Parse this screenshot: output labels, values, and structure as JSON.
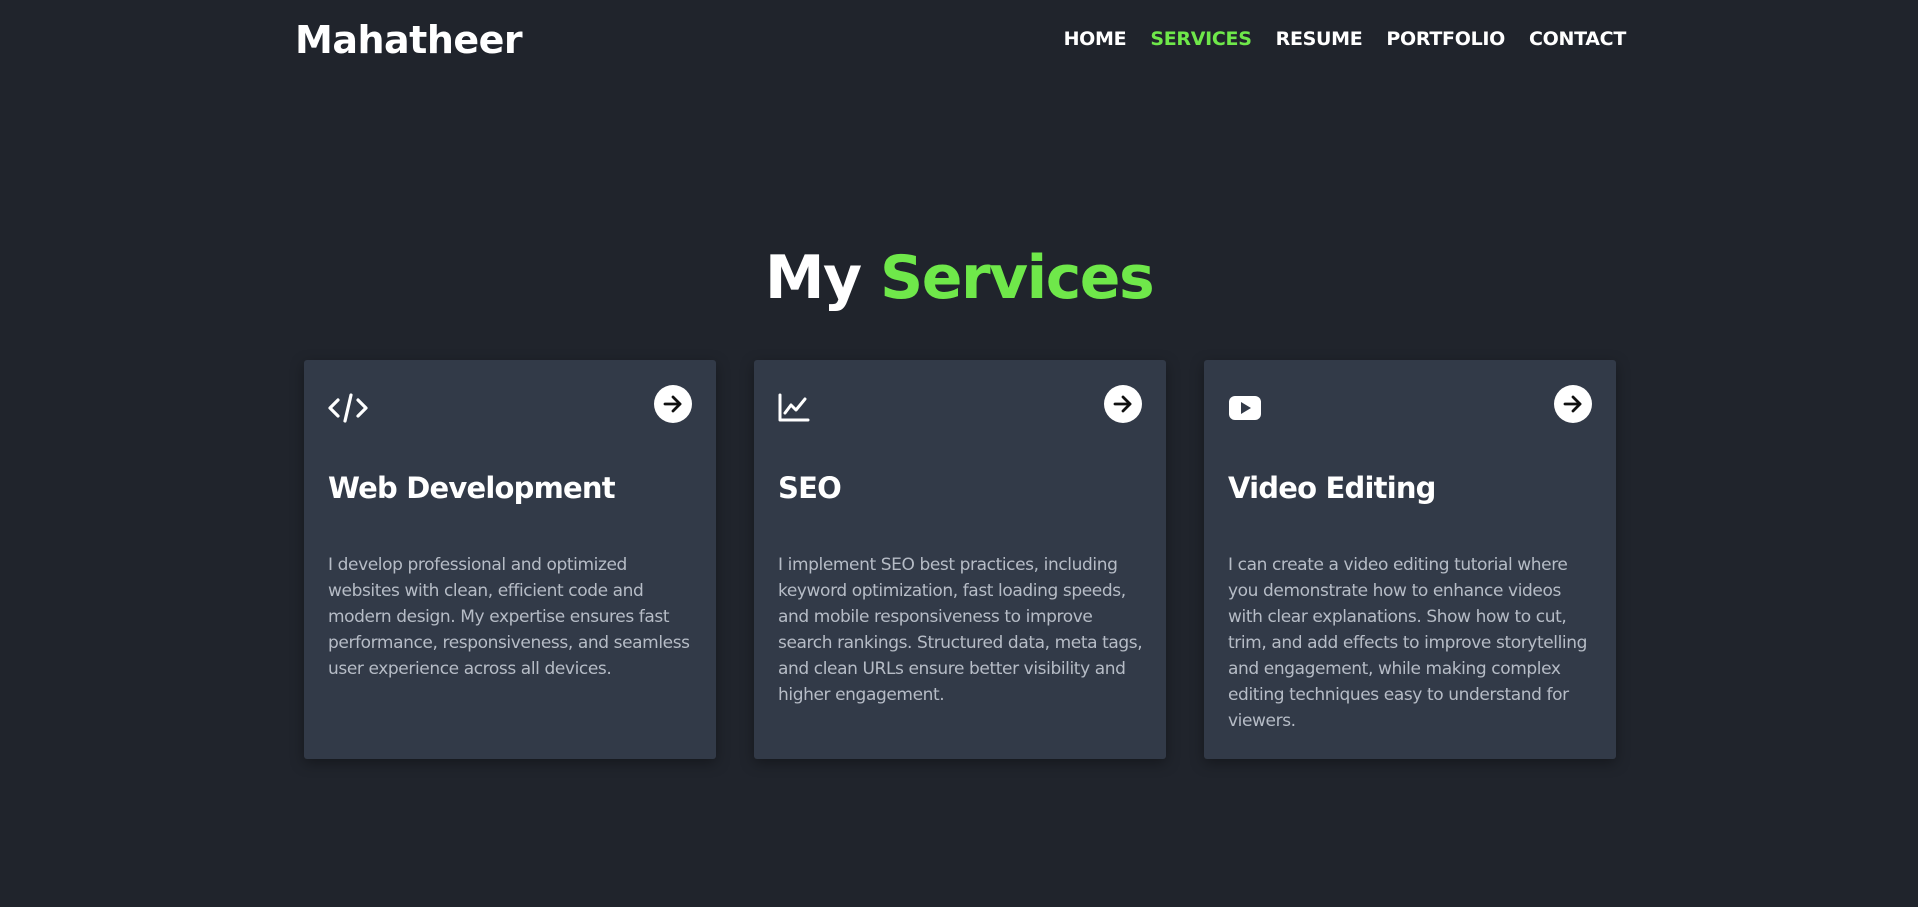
{
  "header": {
    "logo": "Mahatheer",
    "nav": [
      {
        "label": "HOME",
        "active": false
      },
      {
        "label": "SERVICES",
        "active": true
      },
      {
        "label": "RESUME",
        "active": false
      },
      {
        "label": "PORTFOLIO",
        "active": false
      },
      {
        "label": "CONTACT",
        "active": false
      }
    ]
  },
  "section": {
    "title_prefix": "My",
    "title_accent": "Services"
  },
  "cards": [
    {
      "icon": "code-icon",
      "title": "Web Development",
      "description": "I develop professional and optimized websites with clean, efficient code and modern design. My expertise ensures fast performance, responsiveness, and seamless user experience across all devices."
    },
    {
      "icon": "chart-line-icon",
      "title": "SEO",
      "description": "I implement SEO best practices, including keyword optimization, fast loading speeds, and mobile responsiveness to improve search rankings. Structured data, meta tags, and clean URLs ensure better visibility and higher engagement."
    },
    {
      "icon": "youtube-icon",
      "title": "Video Editing",
      "description": "I can create a video editing tutorial where you demonstrate how to enhance videos with clear explanations. Show how to cut, trim, and add effects to improve storytelling and engagement, while making complex editing techniques easy to understand for viewers."
    }
  ],
  "colors": {
    "background": "#20242c",
    "card_background": "#323a48",
    "accent": "#6fe84a",
    "text": "#ffffff",
    "muted_text": "#b6bcc6"
  }
}
